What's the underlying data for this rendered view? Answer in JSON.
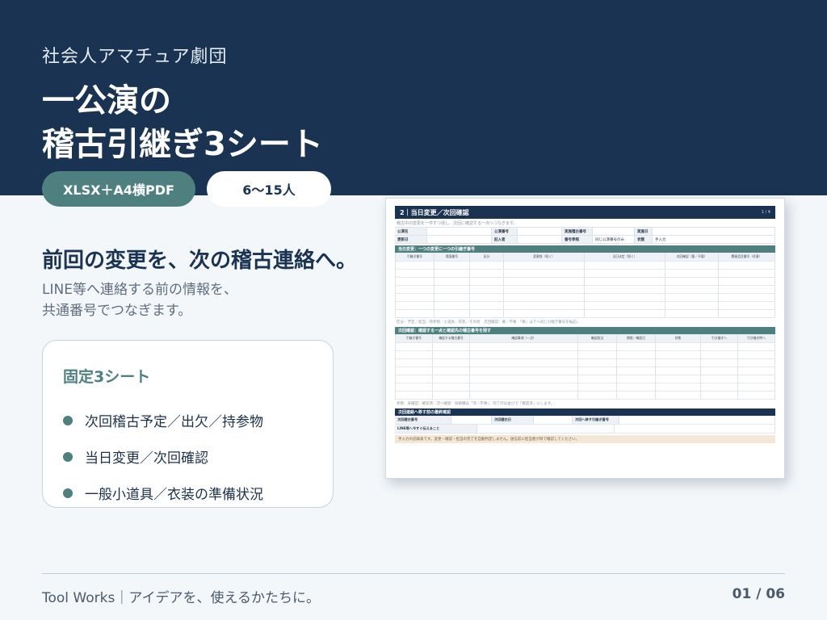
{
  "header": {
    "org": "社会人アマチュア劇団",
    "title_line1": "一公演の",
    "title_line2": "稽古引継ぎ3シート"
  },
  "tags": [
    "XLSX＋A4横PDF",
    "6〜15人"
  ],
  "headline": "前回の変更を、次の稽古連絡へ。",
  "subtext_line1": "LINE等へ連絡する前の情報を、",
  "subtext_line2": "共通番号でつなぎます。",
  "card": {
    "title": "固定3シート",
    "items": [
      "次回稽古予定／出欠／持参物",
      "当日変更／次回確認",
      "一般小道具／衣装の準備状況"
    ]
  },
  "sheet": {
    "title": "2｜当日変更／次回確認",
    "page": "1 / 4",
    "note": "稽古中の変更を一件ずつ残し、次回に確認する一点へつなぎます。",
    "meta_rows": [
      [
        "公演名",
        "",
        "公演番号",
        "",
        "実施稽古番号",
        "",
        "実施日",
        ""
      ],
      [
        "更新日",
        "",
        "記入者",
        "",
        "番号参照",
        "同じ公演番号のみ",
        "状態",
        "手入力"
      ]
    ],
    "section1": "当日変更：一つの変更に一つの引継ぎ番号",
    "grid1_headers": [
      "引継ぎ番号",
      "場面番号",
      "区分",
      "変更前（短く）",
      "当日決定（短く）",
      "次回確認（要／不要）",
      "関連品目番号（任意）"
    ],
    "grid1_foot": "区分：予定／担当／持参物／小道具／衣装／その他　次回確認：要／不要　「要」は下へ同じ引継ぎ番号を転記。",
    "section2": "次回確認：確認する一点と確認先の稽古番号を残す",
    "grid2_headers": [
      "引継ぎ番号",
      "確認する稽古番号",
      "確認事項（一点）",
      "確認担当",
      "期限／確認日",
      "状態",
      "引き継ぎへ",
      "引き継ぎ時へ"
    ],
    "grid2_foot": "状態：未確認／確認済／次へ継続　技術欄は「済／不要」、完了行は並びで「確認済」にします。",
    "section3": "次回連絡へ移す前の最終確認",
    "final_rows": [
      [
        "次回稽古番号",
        "",
        "次回稽古日",
        "",
        "次回へ移す引継ぎ番号",
        ""
      ],
      [
        "LINE等へ今すぐ伝えること",
        "",
        "",
        "",
        "",
        ""
      ]
    ],
    "bottom_note": "手入力の記録表です。変更・確認・担当の完了を自動判定しません。送信前に担当者が目で確認してください。"
  },
  "footer": "Tool Works｜アイデアを、使えるかたちに。",
  "page_indicator": "01 / 06"
}
